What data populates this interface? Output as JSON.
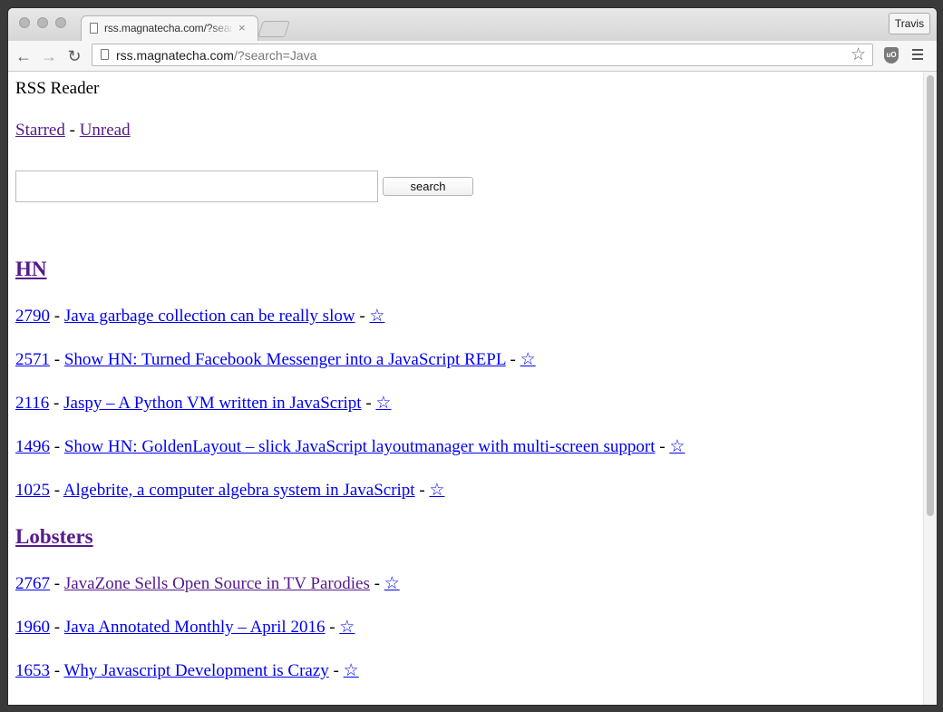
{
  "browser": {
    "tab_title": "rss.magnatecha.com/?search=Java",
    "tab_close": "×",
    "profile_name": "Travis",
    "url_host": "rss.magnatecha.com",
    "url_path": "/?search=Java",
    "back_glyph": "←",
    "forward_glyph": "→",
    "reload_glyph": "↻",
    "star_glyph": "☆",
    "ublock_label": "uO"
  },
  "page": {
    "title": "RSS Reader",
    "nav": {
      "starred": "Starred",
      "separator": " - ",
      "unread": "Unread"
    },
    "search": {
      "value": "",
      "button_label": "search"
    },
    "feeds": [
      {
        "name": "HN",
        "items": [
          {
            "score": "2790",
            "title": "Java garbage collection can be really slow",
            "star": "☆"
          },
          {
            "score": "2571",
            "title": "Show HN: Turned Facebook Messenger into a JavaScript REPL",
            "star": "☆"
          },
          {
            "score": "2116",
            "title": "Jaspy – A Python VM written in JavaScript",
            "star": "☆"
          },
          {
            "score": "1496",
            "title": "Show HN: GoldenLayout – slick JavaScript layoutmanager with multi-screen support",
            "star": "☆"
          },
          {
            "score": "1025",
            "title": "Algebrite, a computer algebra system in JavaScript",
            "star": "☆"
          }
        ]
      },
      {
        "name": "Lobsters",
        "items": [
          {
            "score": "2767",
            "title": "JavaZone Sells Open Source in TV Parodies",
            "star": "☆"
          },
          {
            "score": "1960",
            "title": "Java Annotated Monthly – April 2016",
            "star": "☆"
          },
          {
            "score": "1653",
            "title": "Why Javascript Development is Crazy",
            "star": "☆"
          }
        ]
      }
    ],
    "item_separator": " - "
  },
  "colors": {
    "link": "#0000ee",
    "visited_link": "#551a8b"
  }
}
